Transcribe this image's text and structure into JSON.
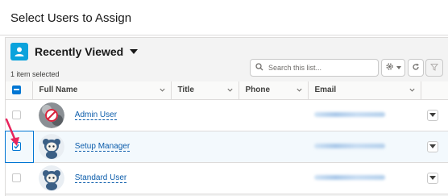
{
  "modal": {
    "title": "Select Users to Assign"
  },
  "list_view": {
    "title": "Recently Viewed",
    "selected_count": "1 item selected"
  },
  "search": {
    "placeholder": "Search this list..."
  },
  "columns": [
    "Full Name",
    "Title",
    "Phone",
    "Email"
  ],
  "rows": [
    {
      "name": "Admin User",
      "checked": false,
      "avatar": "admin-photo"
    },
    {
      "name": "Setup Manager",
      "checked": true,
      "avatar": "astro-character"
    },
    {
      "name": "Standard User",
      "checked": false,
      "avatar": "astro-character"
    }
  ],
  "colors": {
    "accent": "#0176d3",
    "link": "#0b5cab",
    "list_icon": "#0ba3dc",
    "annotation_arrow": "#e8245c"
  },
  "icons": [
    "list-view-icon",
    "search-icon",
    "gear-icon",
    "refresh-icon",
    "filter-icon",
    "chevron-down-icon"
  ]
}
